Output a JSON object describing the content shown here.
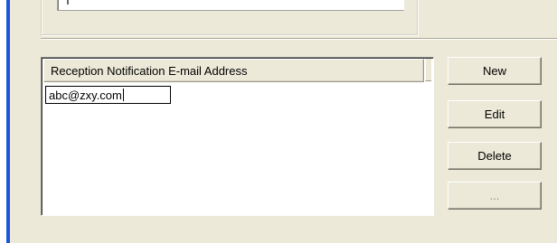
{
  "email_list": {
    "column_header": "Reception Notification E-mail Address",
    "editing_value": "abc@zxy.com"
  },
  "buttons": {
    "new_label": "New",
    "edit_label": "Edit",
    "delete_label": "Delete",
    "more_label": "..."
  },
  "colors": {
    "panel_background": "#ece9d8",
    "window_accent": "#1a57d6",
    "list_background": "#ffffff",
    "disabled_text": "#8d8d8d"
  }
}
